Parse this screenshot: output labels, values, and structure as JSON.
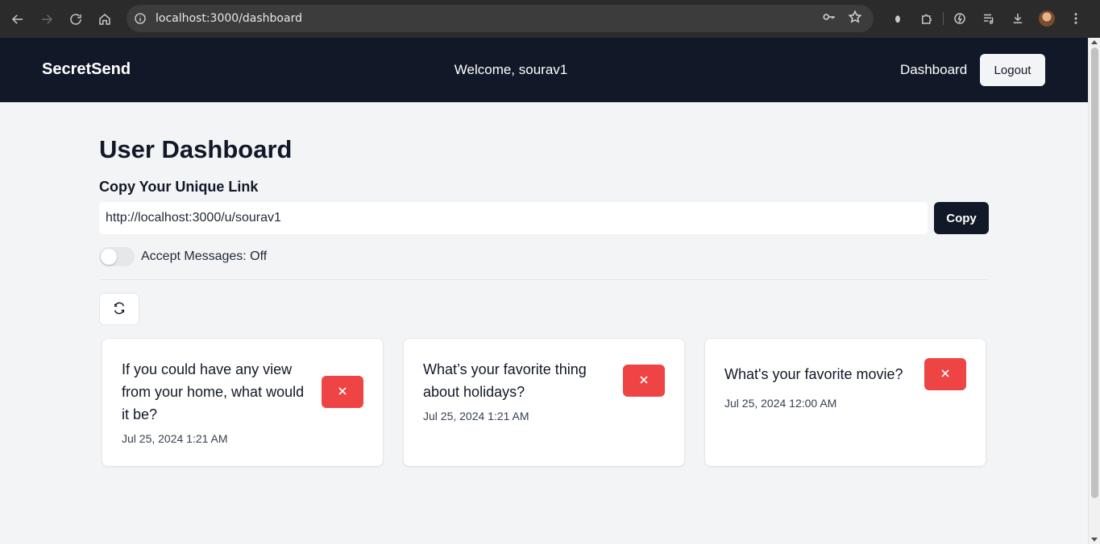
{
  "browser": {
    "url": "localhost:3000/dashboard"
  },
  "header": {
    "brand": "SecretSend",
    "welcome": "Welcome, sourav1",
    "nav_dashboard": "Dashboard",
    "logout_label": "Logout"
  },
  "main": {
    "title": "User Dashboard",
    "link_section_label": "Copy Your Unique Link",
    "unique_link": "http://localhost:3000/u/sourav1",
    "copy_label": "Copy",
    "accept_messages_label": "Accept Messages: Off",
    "accept_messages_on": false,
    "messages": [
      {
        "text": "If you could have any view from your home, what would it be?",
        "date": "Jul 25, 2024 1:21 AM"
      },
      {
        "text": "What’s your favorite thing about holidays?",
        "date": "Jul 25, 2024 1:21 AM"
      },
      {
        "text": "What's your favorite movie?",
        "date": "Jul 25, 2024 12:00 AM"
      }
    ]
  },
  "colors": {
    "header_bg": "#111827",
    "page_bg": "#f3f4f6",
    "delete_red": "#ef4444",
    "primary_dark": "#111827"
  },
  "icons": [
    "back-icon",
    "forward-icon",
    "reload-icon",
    "home-icon",
    "site-info-icon",
    "password-key-icon",
    "bookmark-star-icon",
    "extension-icon",
    "puzzle-icon",
    "performance-icon",
    "media-icon",
    "download-icon",
    "profile-avatar",
    "menu-icon",
    "refresh-icon",
    "close-icon"
  ]
}
